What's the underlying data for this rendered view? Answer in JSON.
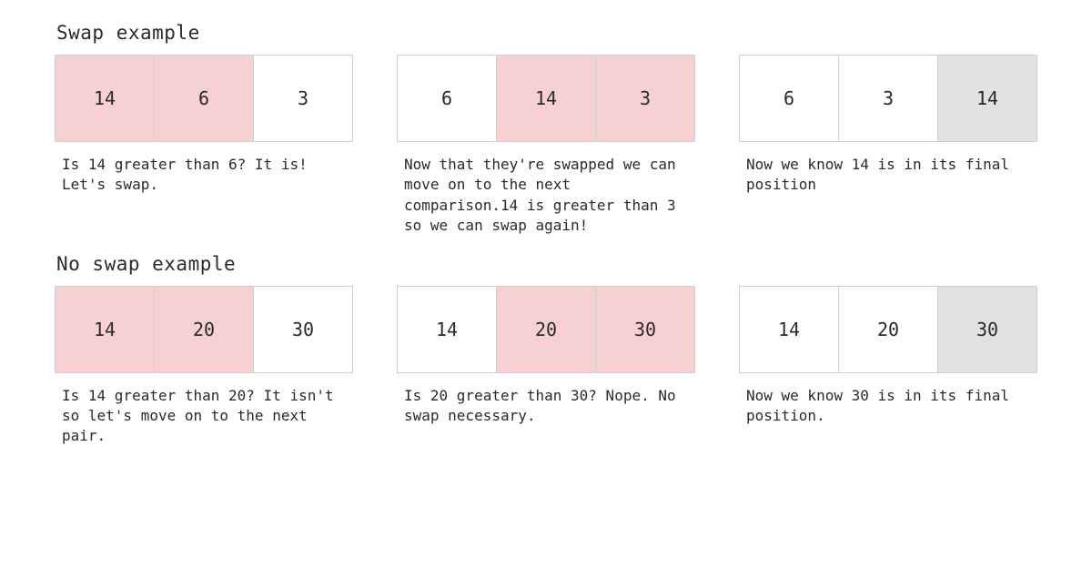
{
  "colors": {
    "highlight_compare": "#f7d0d1",
    "highlight_final": "#e3e1e4",
    "cell_border": "#d0d0d0"
  },
  "examples": [
    {
      "title": "Swap example",
      "steps": [
        {
          "cells": [
            {
              "value": "14",
              "state": "pink"
            },
            {
              "value": "6",
              "state": "pink"
            },
            {
              "value": "3",
              "state": "plain"
            }
          ],
          "caption": "Is 14 greater than 6? It is! Let's swap."
        },
        {
          "cells": [
            {
              "value": "6",
              "state": "plain"
            },
            {
              "value": "14",
              "state": "pink"
            },
            {
              "value": "3",
              "state": "pink"
            }
          ],
          "caption": "Now that they're swapped we can move on to the next comparison.14 is greater than 3 so we can swap again!"
        },
        {
          "cells": [
            {
              "value": "6",
              "state": "plain"
            },
            {
              "value": "3",
              "state": "plain"
            },
            {
              "value": "14",
              "state": "grey"
            }
          ],
          "caption": "Now we know 14 is in its final position"
        }
      ]
    },
    {
      "title": "No swap example",
      "steps": [
        {
          "cells": [
            {
              "value": "14",
              "state": "pink"
            },
            {
              "value": "20",
              "state": "pink"
            },
            {
              "value": "30",
              "state": "plain"
            }
          ],
          "caption": "Is 14 greater than 20? It isn't so let's move on to the next pair."
        },
        {
          "cells": [
            {
              "value": "14",
              "state": "plain"
            },
            {
              "value": "20",
              "state": "pink"
            },
            {
              "value": "30",
              "state": "pink"
            }
          ],
          "caption": "Is 20 greater than 30? Nope. No swap necessary."
        },
        {
          "cells": [
            {
              "value": "14",
              "state": "plain"
            },
            {
              "value": "20",
              "state": "plain"
            },
            {
              "value": "30",
              "state": "grey"
            }
          ],
          "caption": "Now we know 30 is in its final position."
        }
      ]
    }
  ]
}
